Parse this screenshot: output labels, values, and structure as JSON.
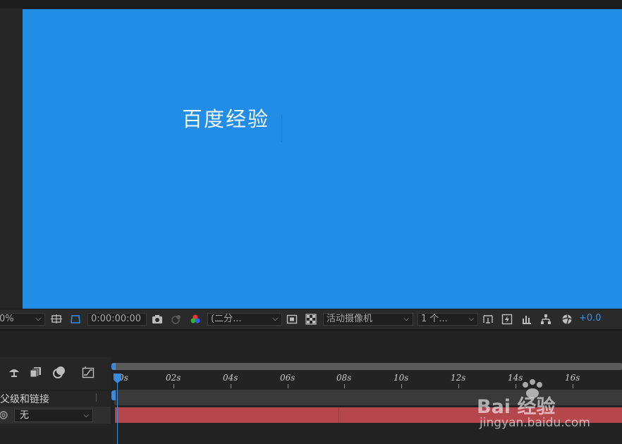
{
  "composition": {
    "background_color": "#218de6",
    "text": "百度经验",
    "text_color": "#f4f7fb",
    "cursor_color": "#c23a5a"
  },
  "viewer_toolbar": {
    "zoom": "0%",
    "timecode": "0:00:00:00",
    "resolution": "(二分...",
    "camera": "活动摄像机",
    "views": "1 个...",
    "exposure": "+0.0",
    "icons": [
      "region-of-interest-icon",
      "transparency-grid-toggle-icon",
      "snapshot-camera-icon",
      "show-snapshot-icon",
      "color-channels-icon",
      "view-icon",
      "checkerboard-icon",
      "view-options-icon",
      "fast-preview-icon",
      "timeline-icon",
      "flowchart-icon",
      "reset-exposure-icon"
    ]
  },
  "timeline": {
    "ruler_ticks": [
      "0s",
      "02s",
      "04s",
      "06s",
      "08s",
      "10s",
      "12s",
      "14s",
      "16s"
    ],
    "column_header": "父级和链接",
    "parent_value": "无",
    "layer_bar_color": "#b5464b",
    "playhead_color": "#3a8be0",
    "icons": [
      "comp-flowchart-icon",
      "frame-blending-icon",
      "motion-blur-icon",
      "graph-editor-icon"
    ]
  },
  "watermark": {
    "logo": "Bai 经验",
    "url": "jingyan.baidu.com"
  }
}
